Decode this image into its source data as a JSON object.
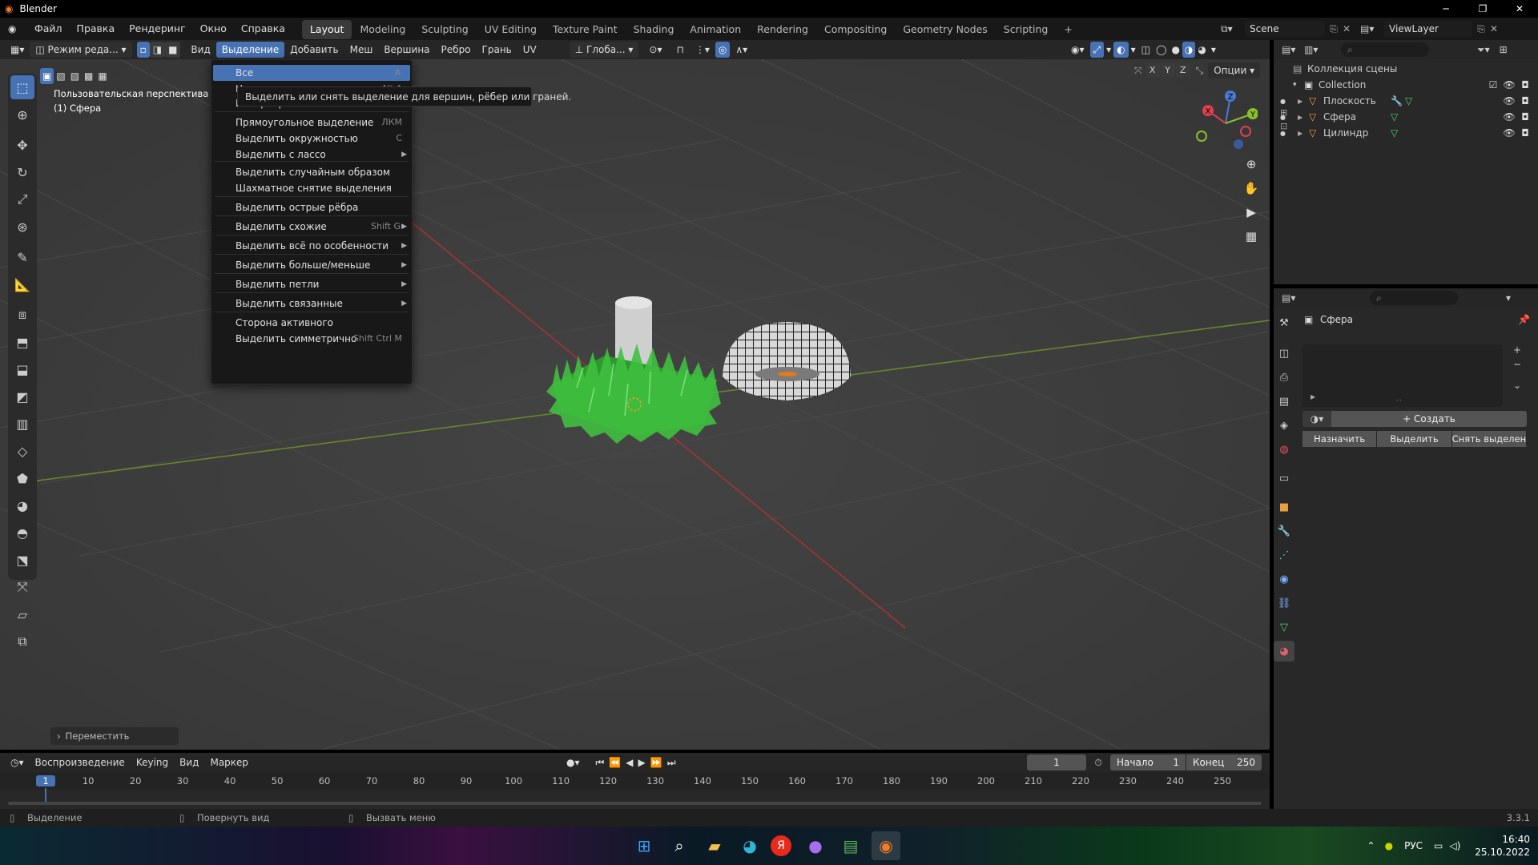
{
  "app": {
    "title": "Blender",
    "version": "3.3.1"
  },
  "menubar": {
    "items": [
      "Файл",
      "Правка",
      "Рендеринг",
      "Окно",
      "Справка"
    ],
    "workspaces": [
      "Layout",
      "Modeling",
      "Sculpting",
      "UV Editing",
      "Texture Paint",
      "Shading",
      "Animation",
      "Rendering",
      "Compositing",
      "Geometry Nodes",
      "Scripting"
    ],
    "active_workspace": "Layout",
    "add_tab": "+",
    "scene": "Scene",
    "view_layer": "ViewLayer"
  },
  "viewport_header": {
    "mode": "Режим реда...",
    "menus": [
      "Вид",
      "Выделение",
      "Добавить",
      "Меш",
      "Вершина",
      "Ребро",
      "Грань",
      "UV"
    ],
    "active_menu": "Выделение",
    "transform_orientation": "Глоба...",
    "options_label": "Опции",
    "axes": [
      "X",
      "Y",
      "Z"
    ]
  },
  "viewport": {
    "perspective_label": "Пользовательская перспектива",
    "object_label": "(1) Сфера",
    "last_operator": "Переместить",
    "gizmo": {
      "x": "X",
      "y": "Y",
      "z": "Z"
    }
  },
  "select_menu": {
    "items": [
      {
        "label": "Все",
        "shortcut": "A",
        "highlighted": true
      },
      {
        "label": "Ничего",
        "shortcut": "Alt A"
      },
      {
        "label": "Инвертировать",
        "shortcut": "Ctrl I"
      },
      {
        "label": "Прямоугольное выделение",
        "shortcut": "ЛКМ"
      },
      {
        "label": "Выделить окружностью",
        "shortcut": "C"
      },
      {
        "label": "Выделить с лассо",
        "submenu": true
      },
      {
        "label": "Выделить случайным образом"
      },
      {
        "label": "Шахматное снятие выделения"
      },
      {
        "label": "Выделить острые рёбра"
      },
      {
        "label": "Выделить схожие",
        "shortcut": "Shift G",
        "submenu": true
      },
      {
        "label": "Выделить всё по особенности",
        "submenu": true
      },
      {
        "label": "Выделить больше/меньше",
        "submenu": true
      },
      {
        "label": "Выделить петли",
        "submenu": true
      },
      {
        "label": "Выделить связанные",
        "submenu": true
      },
      {
        "label": "Сторона активного"
      },
      {
        "label": "Выделить симметрично",
        "shortcut": "Shift Ctrl M"
      }
    ],
    "tooltip": "Выделить или снять выделение для вершин, рёбер или граней."
  },
  "outliner": {
    "root": "Коллекция сцены",
    "collection": "Collection",
    "objects": [
      "Плоскость",
      "Сфера",
      "Цилиндр"
    ]
  },
  "properties": {
    "object_name": "Сфера",
    "new_button": "Создать",
    "buttons": [
      "Назначить",
      "Выделить",
      "Снять выделен..."
    ]
  },
  "timeline": {
    "menus": [
      "Воспроизведение",
      "Keying",
      "Вид",
      "Маркер"
    ],
    "current_frame": "1",
    "start_label": "Начало",
    "start": "1",
    "end_label": "Конец",
    "end": "250",
    "ruler": [
      "1",
      "10",
      "20",
      "30",
      "40",
      "50",
      "60",
      "70",
      "80",
      "90",
      "100",
      "110",
      "120",
      "130",
      "140",
      "150",
      "160",
      "170",
      "180",
      "190",
      "200",
      "210",
      "220",
      "230",
      "240",
      "250"
    ]
  },
  "statusbar": {
    "hints": [
      "Выделение",
      "Повернуть вид",
      "Вызвать меню"
    ],
    "version": "3.3.1"
  },
  "taskbar": {
    "language": "РУС",
    "time": "16:40",
    "date": "25.10.2022"
  }
}
